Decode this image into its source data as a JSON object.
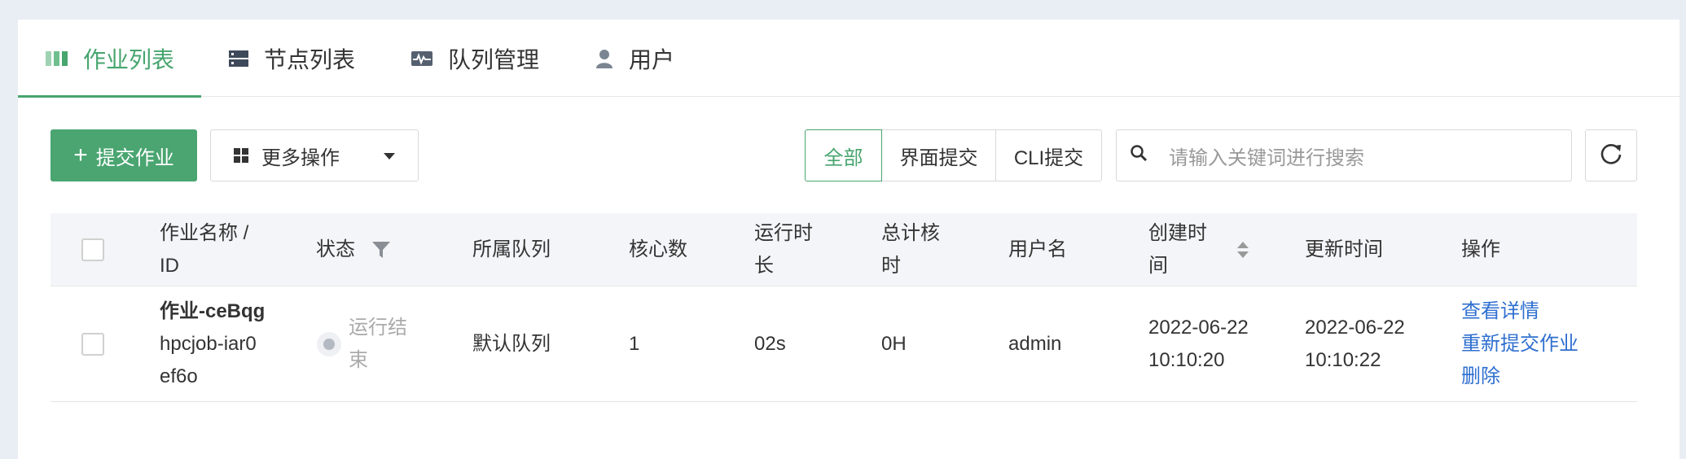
{
  "tabs": [
    {
      "label": "作业列表",
      "icon": "bars-icon",
      "active": true
    },
    {
      "label": "节点列表",
      "icon": "server-icon",
      "active": false
    },
    {
      "label": "队列管理",
      "icon": "pulse-icon",
      "active": false
    },
    {
      "label": "用户",
      "icon": "user-icon",
      "active": false
    }
  ],
  "toolbar": {
    "submit_label": "提交作业",
    "more_label": "更多操作",
    "filter_all": "全部",
    "filter_ui": "界面提交",
    "filter_cli": "CLI提交",
    "search_placeholder": "请输入关键词进行搜索"
  },
  "table": {
    "headers": {
      "name": [
        "作业名称 /",
        "ID"
      ],
      "status": "状态",
      "queue": "所属队列",
      "cores": "核心数",
      "runtime": [
        "运行时",
        "长"
      ],
      "core_hours": [
        "总计核",
        "时"
      ],
      "user": "用户名",
      "created": [
        "创建时",
        "间"
      ],
      "updated": "更新时间",
      "actions": "操作"
    },
    "rows": [
      {
        "name": "作业-ceBqg",
        "id": [
          "hpcjob-iar0",
          "ef6o"
        ],
        "status": [
          "运行结",
          "束"
        ],
        "queue": "默认队列",
        "cores": "1",
        "runtime": "02s",
        "core_hours": "0H",
        "user": "admin",
        "created": [
          "2022-06-22",
          "10:10:20"
        ],
        "updated": [
          "2022-06-22",
          "10:10:22"
        ],
        "actions": [
          "查看详情",
          "重新提交作业",
          "删除"
        ]
      }
    ]
  },
  "colors": {
    "accent": "#47a56e",
    "link": "#2f6fd0"
  }
}
